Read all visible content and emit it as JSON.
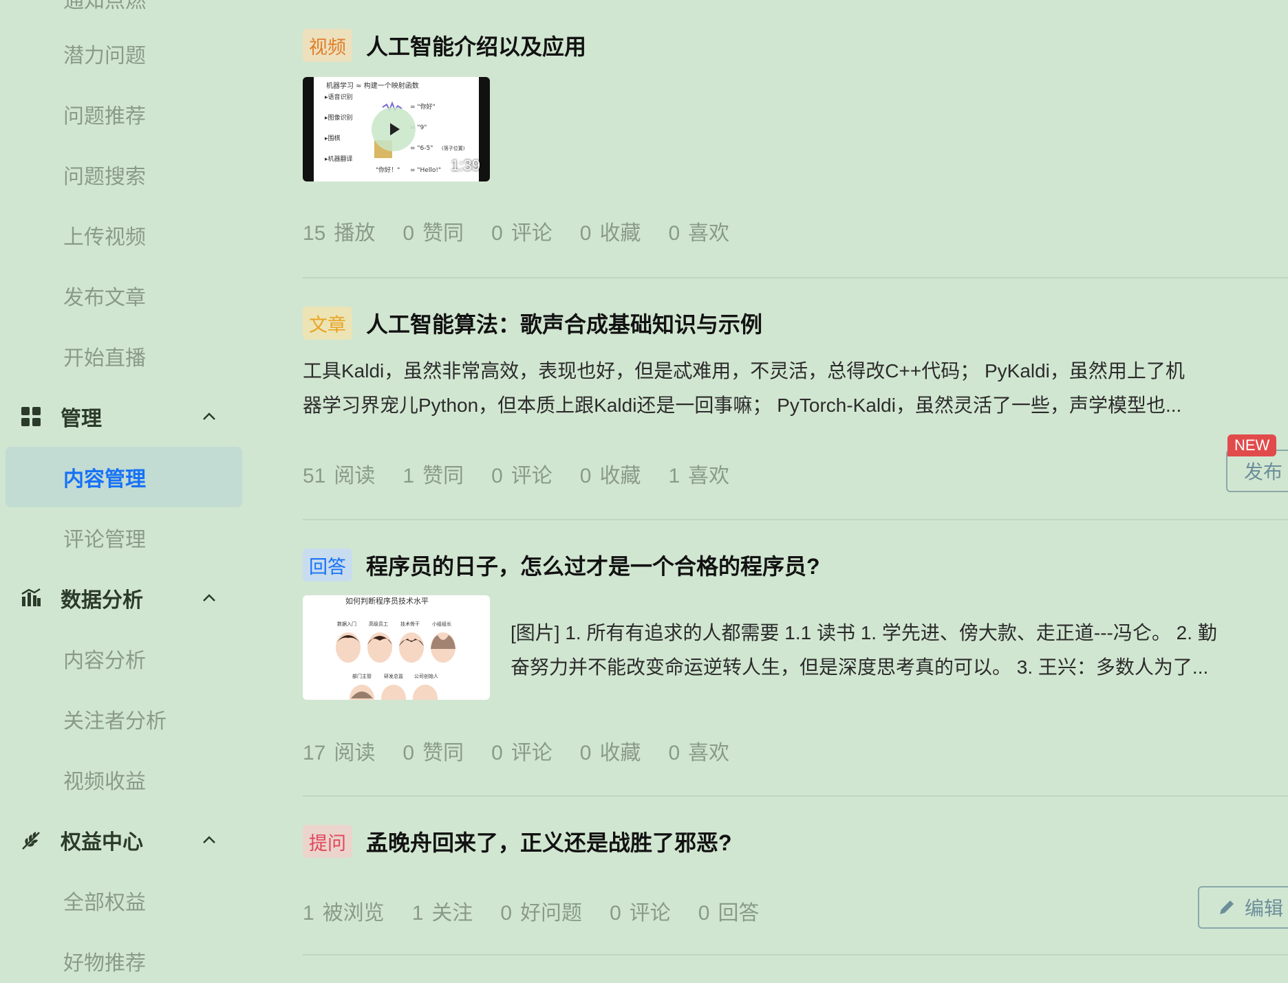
{
  "sidebar": {
    "partial_top_label": "通知点燃",
    "items": [
      {
        "label": "潜力问题"
      },
      {
        "label": "问题推荐"
      },
      {
        "label": "问题搜索"
      },
      {
        "label": "上传视频"
      },
      {
        "label": "发布文章"
      },
      {
        "label": "开始直播"
      }
    ],
    "sections": [
      {
        "label": "管理",
        "icon": "grid-icon",
        "items": [
          {
            "label": "内容管理",
            "active": true
          },
          {
            "label": "评论管理"
          }
        ]
      },
      {
        "label": "数据分析",
        "icon": "bar-chart-icon",
        "items": [
          {
            "label": "内容分析"
          },
          {
            "label": "关注者分析"
          },
          {
            "label": "视频收益"
          }
        ]
      },
      {
        "label": "权益中心",
        "icon": "leaf-icon",
        "items": [
          {
            "label": "全部权益"
          },
          {
            "label": "好物推荐"
          }
        ]
      }
    ]
  },
  "feed": {
    "cards": [
      {
        "tag": "视频",
        "title": "人工智能介绍以及应用",
        "video": {
          "duration": "1:39",
          "slide_title": "机器学习 ≈ 构建一个映射函数",
          "slide_lines": [
            "▸语音识别",
            "▸图像识别",
            "▸围棋",
            "▸机器翻译"
          ],
          "slide_outputs": [
            "= \"你好\"",
            "= \"9\"",
            "= \"6-5\"",
            "= \"Hello!\""
          ],
          "slide_note": "(落子位置)",
          "slide_input": "\"你好！\""
        },
        "stats": [
          {
            "num": "15",
            "label": "播放"
          },
          {
            "num": "0",
            "label": "赞同"
          },
          {
            "num": "0",
            "label": "评论"
          },
          {
            "num": "0",
            "label": "收藏"
          },
          {
            "num": "0",
            "label": "喜欢"
          }
        ]
      },
      {
        "tag": "文章",
        "title": "人工智能算法：歌声合成基础知识与示例",
        "excerpt_line1": "工具Kaldi，虽然非常高效，表现也好，但是忒难用，不灵活，总得改C++代码； PyKaldi，虽然用上了机",
        "excerpt_line2": "器学习界宠儿Python，但本质上跟Kaldi还是一回事嘛； PyTorch-Kaldi，虽然灵活了一些，声学模型也...",
        "stats": [
          {
            "num": "51",
            "label": "阅读"
          },
          {
            "num": "1",
            "label": "赞同"
          },
          {
            "num": "0",
            "label": "评论"
          },
          {
            "num": "0",
            "label": "收藏"
          },
          {
            "num": "1",
            "label": "喜欢"
          }
        ],
        "publish_button": "发布",
        "new_badge": "NEW"
      },
      {
        "tag": "回答",
        "title": "程序员的日子，怎么过才是一个合格的程序员?",
        "image_caption": "如何判断程序员技术水平",
        "image_labels": [
          "数据入门",
          "高级员工",
          "技术骨干",
          "小组组长",
          "部门主管",
          "研发总监",
          "公司创始人"
        ],
        "excerpt_line1": "[图片] 1. 所有有追求的人都需要 1.1 读书 1. 学先进、傍大款、走正道---冯仑。 2. 勤",
        "excerpt_line2": "奋努力并不能改变命运逆转人生，但是深度思考真的可以。 3. 王兴：多数人为了...",
        "stats": [
          {
            "num": "17",
            "label": "阅读"
          },
          {
            "num": "0",
            "label": "赞同"
          },
          {
            "num": "0",
            "label": "评论"
          },
          {
            "num": "0",
            "label": "收藏"
          },
          {
            "num": "0",
            "label": "喜欢"
          }
        ]
      },
      {
        "tag": "提问",
        "title": "孟晚舟回来了，正义还是战胜了邪恶?",
        "stats": [
          {
            "num": "1",
            "label": "被浏览"
          },
          {
            "num": "1",
            "label": "关注"
          },
          {
            "num": "0",
            "label": "好问题"
          },
          {
            "num": "0",
            "label": "评论"
          },
          {
            "num": "0",
            "label": "回答"
          }
        ],
        "edit_button": "编辑"
      }
    ]
  },
  "colors": {
    "background": "#d1e6d1",
    "active_nav_bg": "#c2dbd3",
    "active_nav_text": "#1772f6",
    "tag_video": "#e07f2b",
    "tag_article": "#e8a325",
    "tag_answer": "#1772f6",
    "tag_question": "#e0465e",
    "new_badge": "#e14b4b"
  }
}
